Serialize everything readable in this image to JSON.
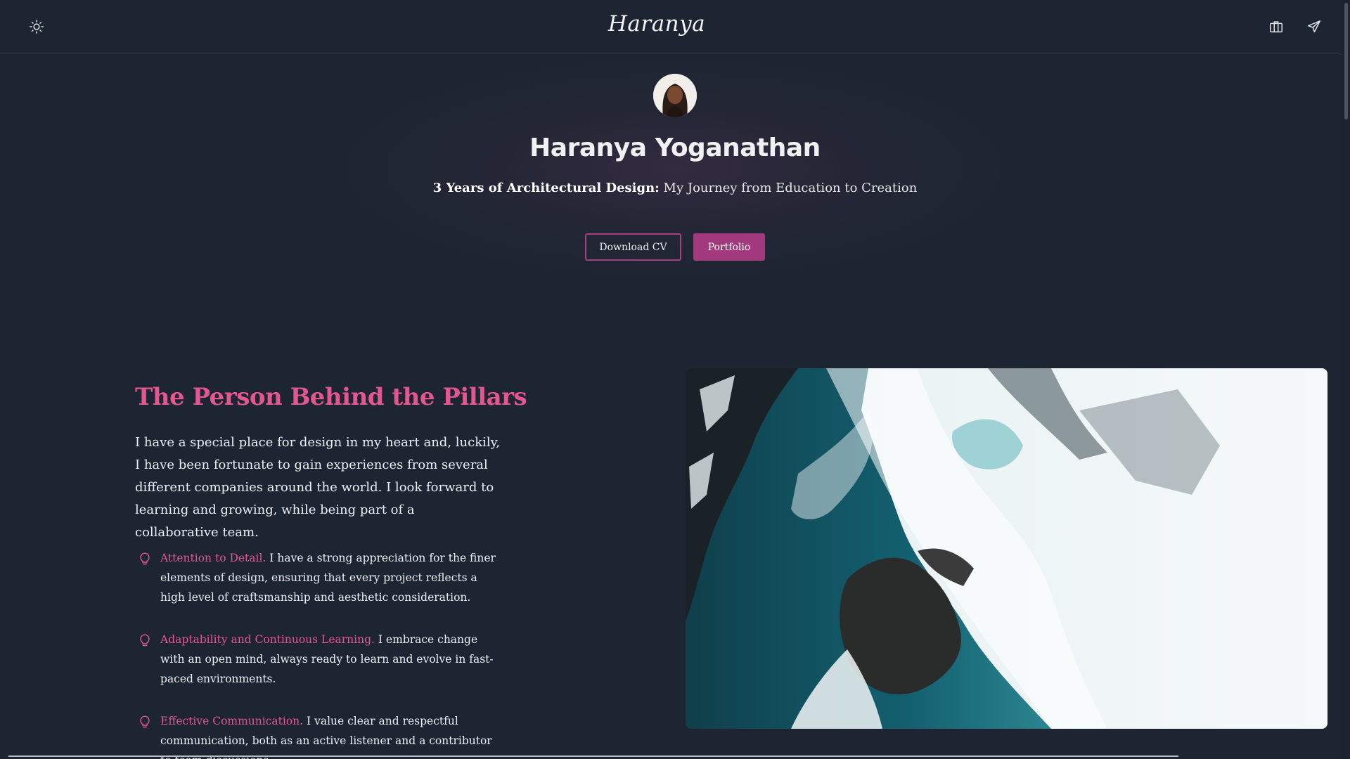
{
  "header": {
    "brand": "Haranya",
    "theme_toggle_icon": "sun-icon",
    "right_icons": [
      "briefcase-icon",
      "send-icon"
    ]
  },
  "hero": {
    "name": "Haranya Yoganathan",
    "tagline_bold": "3 Years of Architectural Design:",
    "tagline_rest": " My Journey from Education to Creation",
    "buttons": {
      "download_cv": "Download CV",
      "portfolio": "Portfolio"
    }
  },
  "about": {
    "heading": "The Person Behind the Pillars",
    "intro": "I have a special place for design in my heart and, luckily, I have been fortunate to gain experiences from several different companies around the world. I look forward to learning and growing, while being part of a collaborative team.",
    "traits": [
      {
        "title": "Attention to Detail.",
        "text": " I have a strong appreciation for the finer elements of design, ensuring that every project reflects a high level of craftsmanship and aesthetic consideration."
      },
      {
        "title": "Adaptability and Continuous Learning.",
        "text": " I embrace change with an open mind, always ready to learn and evolve in fast-paced environments."
      },
      {
        "title": "Effective Communication.",
        "text": " I value clear and respectful communication, both as an active listener and a contributor to team discussions."
      }
    ]
  },
  "colors": {
    "background": "#1e2532",
    "accent_pink": "#e2578f",
    "button_magenta": "#a23a7d"
  }
}
